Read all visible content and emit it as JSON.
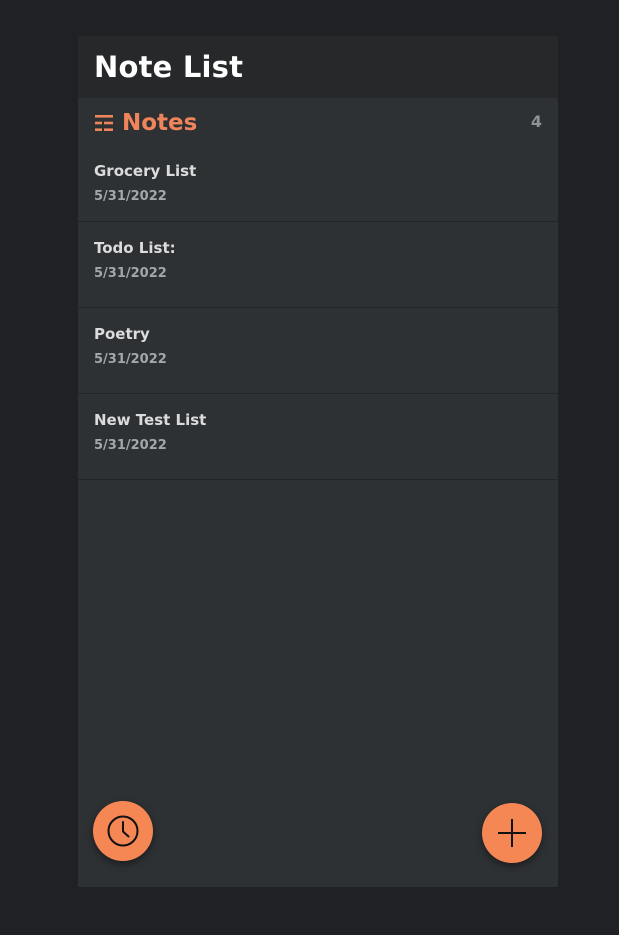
{
  "header": {
    "title": "Note List"
  },
  "notes_section": {
    "heading": "Notes",
    "count": "4",
    "icon": "list-icon",
    "accent_color": "#f0845a"
  },
  "notes": [
    {
      "title": "Grocery List",
      "date": "5/31/2022"
    },
    {
      "title": "Todo List:",
      "date": "5/31/2022"
    },
    {
      "title": "Poetry",
      "date": "5/31/2022"
    },
    {
      "title": "New Test List",
      "date": "5/31/2022"
    }
  ],
  "actions": {
    "history_icon": "clock-icon",
    "add_icon": "plus-icon",
    "fab_color": "#f58755"
  }
}
